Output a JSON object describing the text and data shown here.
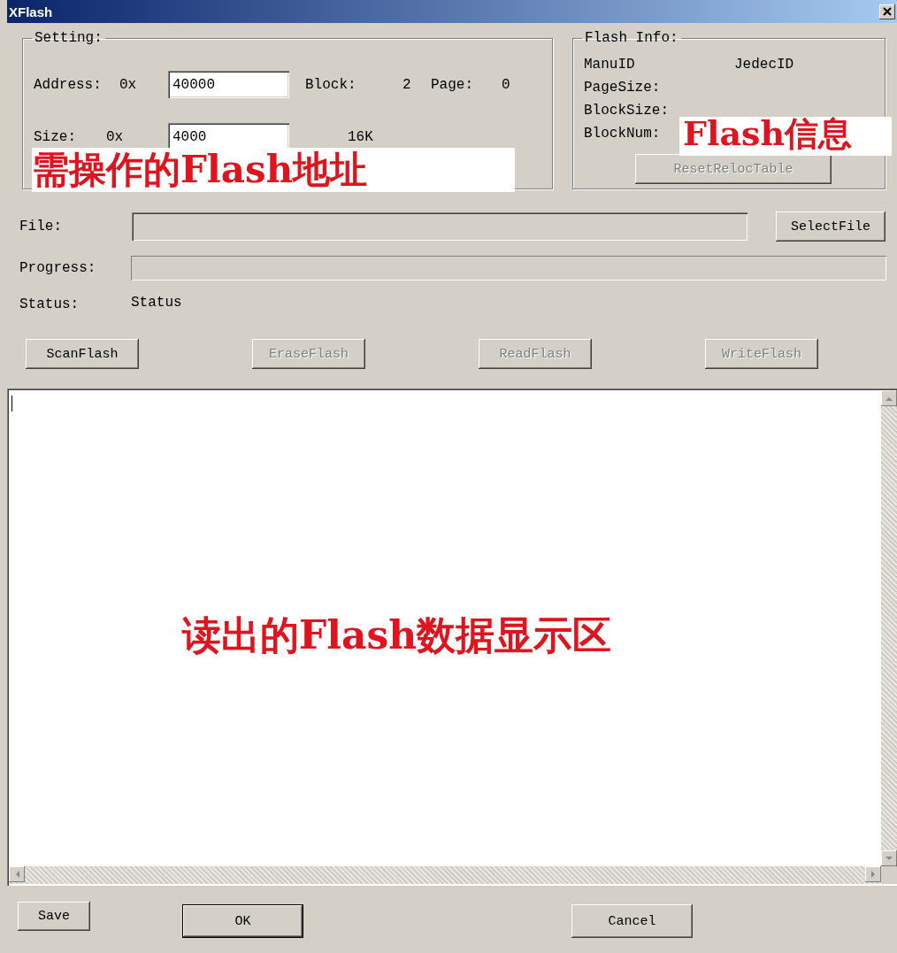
{
  "window": {
    "title": "XFlash"
  },
  "setting": {
    "title": "Setting:",
    "address_label": "Address:",
    "address_prefix": "0x",
    "address": "40000",
    "block_label": "Block:",
    "block": "2",
    "page_label": "Page:",
    "page": "0",
    "size_label": "Size:",
    "size_prefix": "0x",
    "size": "4000",
    "size_kb": "16K",
    "annotation": "需操作的Flash地址"
  },
  "flash_info": {
    "title": "Flash Info:",
    "manu_id": "ManuID",
    "jedec_id": "JedecID",
    "page_size": "PageSize:",
    "block_size": "BlockSize:",
    "block_num": "BlockNum:",
    "reset_button": {
      "label": "ResetRelocTable",
      "disabled": true
    },
    "annotation": "Flash信息"
  },
  "file": {
    "label": "File:",
    "button": {
      "label": "SelectFile",
      "disabled": false
    }
  },
  "progress": {
    "label": "Progress:",
    "level": 0
  },
  "status": {
    "label": "Status:",
    "value": "Status"
  },
  "actions": [
    {
      "label": "ScanFlash",
      "disabled": false
    },
    {
      "label": "EraseFlash",
      "disabled": true
    },
    {
      "label": "ReadFlash",
      "disabled": true
    },
    {
      "label": "WriteFlash",
      "disabled": true
    }
  ],
  "output": {
    "annotation": "读出的Flash数据显示区"
  },
  "footer_buttons": [
    {
      "label": "Save",
      "default": false
    },
    {
      "label": "OK",
      "default": true
    },
    {
      "label": "Cancel",
      "default": false
    }
  ]
}
